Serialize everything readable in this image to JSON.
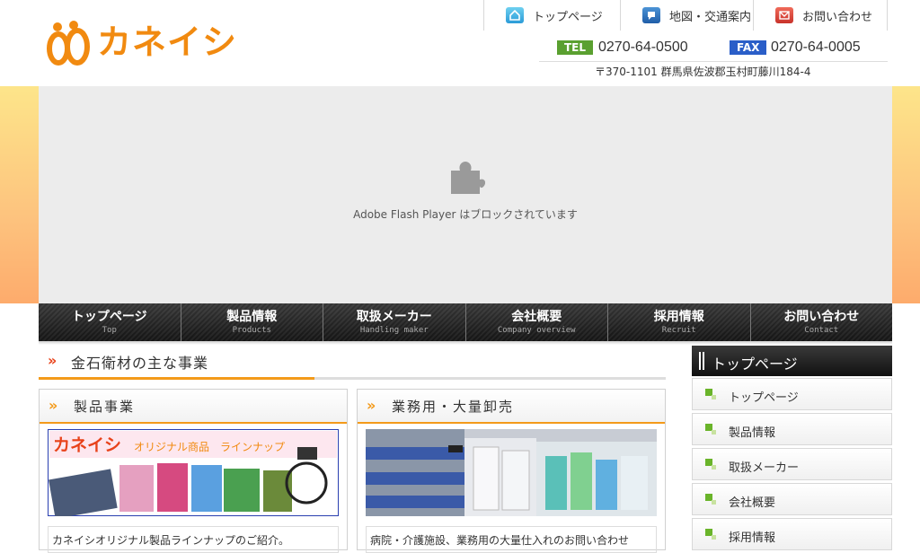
{
  "brand": {
    "name": "カネイシ",
    "accent": "#f18a10"
  },
  "topnav": [
    {
      "label": "トップページ",
      "icon": "home-icon"
    },
    {
      "label": "地図・交通案内",
      "icon": "map-icon"
    },
    {
      "label": "お問い合わせ",
      "icon": "mail-icon"
    }
  ],
  "contact": {
    "tel_tag": "TEL",
    "tel": "0270-64-0500",
    "fax_tag": "FAX",
    "fax": "0270-64-0005",
    "address": "〒370-1101 群馬県佐波郡玉村町藤川184-4"
  },
  "flash": {
    "message": "Adobe Flash Player はブロックされています"
  },
  "mainnav": [
    {
      "label": "トップページ",
      "sub": "Top"
    },
    {
      "label": "製品情報",
      "sub": "Products"
    },
    {
      "label": "取扱メーカー",
      "sub": "Handling maker"
    },
    {
      "label": "会社概要",
      "sub": "Company overview"
    },
    {
      "label": "採用情報",
      "sub": "Recruit"
    },
    {
      "label": "お問い合わせ",
      "sub": "Contact"
    }
  ],
  "main": {
    "section_title": "金石衛材の主な事業",
    "cards": [
      {
        "title": "製品事業",
        "banner_brand": "カネイシ",
        "banner_text": "オリジナル商品　ラインナップ",
        "desc": "カネイシオリジナル製品ラインナップのご紹介。"
      },
      {
        "title": "業務用・大量卸売",
        "desc": "病院・介護施設、業務用の大量仕入れのお問い合わせ"
      }
    ]
  },
  "sidebar": {
    "title": "トップページ",
    "items": [
      {
        "label": "トップページ"
      },
      {
        "label": "製品情報"
      },
      {
        "label": "取扱メーカー"
      },
      {
        "label": "会社概要"
      },
      {
        "label": "採用情報"
      }
    ]
  }
}
